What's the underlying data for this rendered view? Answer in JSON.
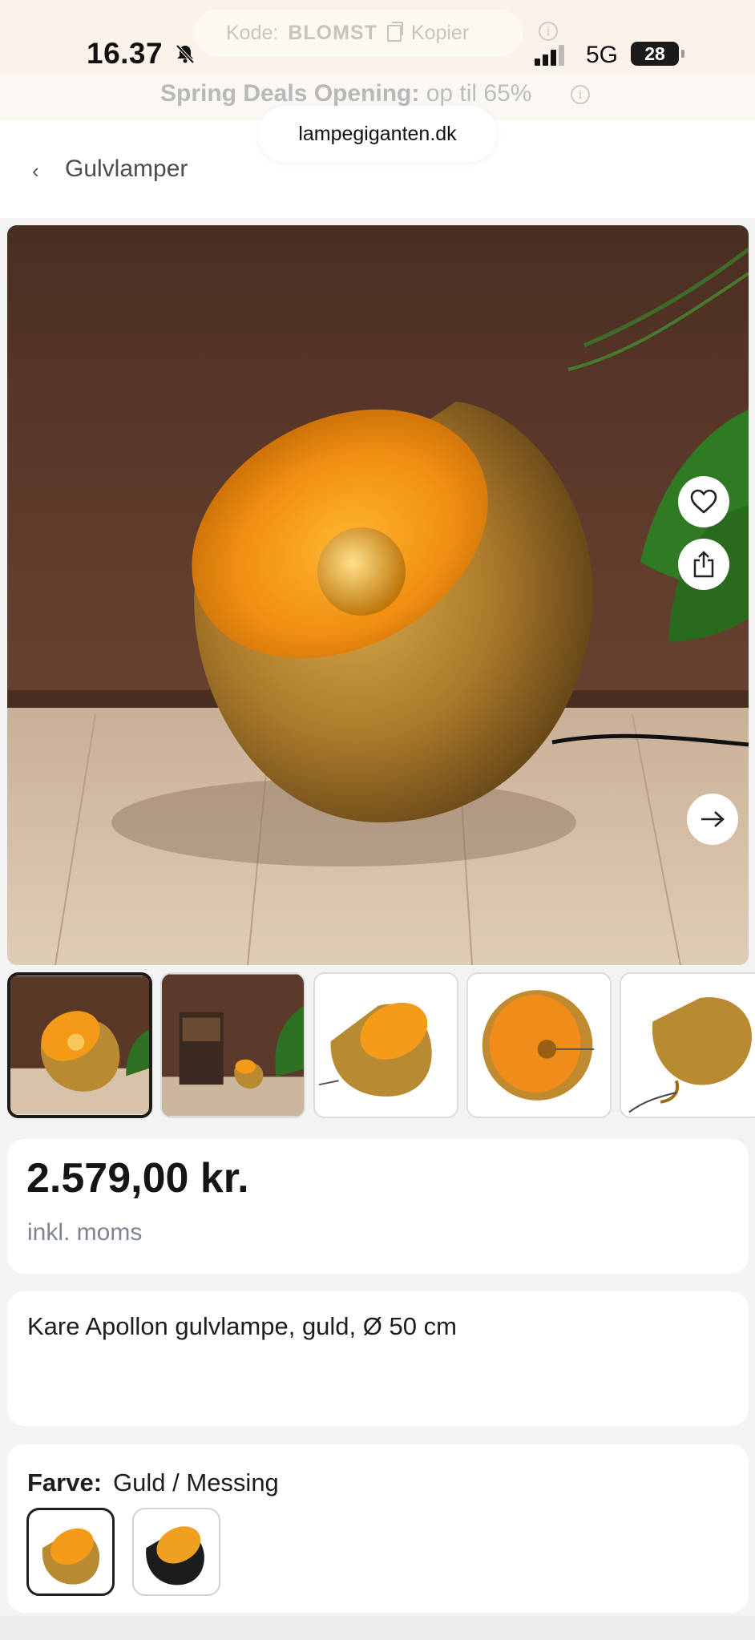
{
  "status_bar": {
    "time": "16.37",
    "network": "5G",
    "battery": "28"
  },
  "promo": {
    "code_label": "Kode:",
    "code_value": "BLOMST",
    "copy_label": "Kopier",
    "deal_title": "Spring Deals Opening:",
    "deal_text": "op til 65%"
  },
  "browser": {
    "url": "lampegiganten.dk"
  },
  "breadcrumb": {
    "label": "Gulvlamper"
  },
  "product": {
    "price": "2.579,00 kr.",
    "vat_note": "inkl. moms",
    "title": "Kare Apollon gulvlampe, guld, Ø 50 cm",
    "color_label": "Farve:",
    "color_value": "Guld / Messing"
  },
  "icons": {
    "favorite": "heart-icon",
    "share": "share-icon",
    "next": "arrow-right-icon",
    "back": "chevron-left-icon",
    "mute": "bell-slash-icon",
    "info": "info-icon",
    "copy": "copy-icon"
  },
  "colors": {
    "accent_gold": "#d49a2a",
    "text_dark": "#1d1d1d",
    "muted_gray": "#7d8690"
  }
}
